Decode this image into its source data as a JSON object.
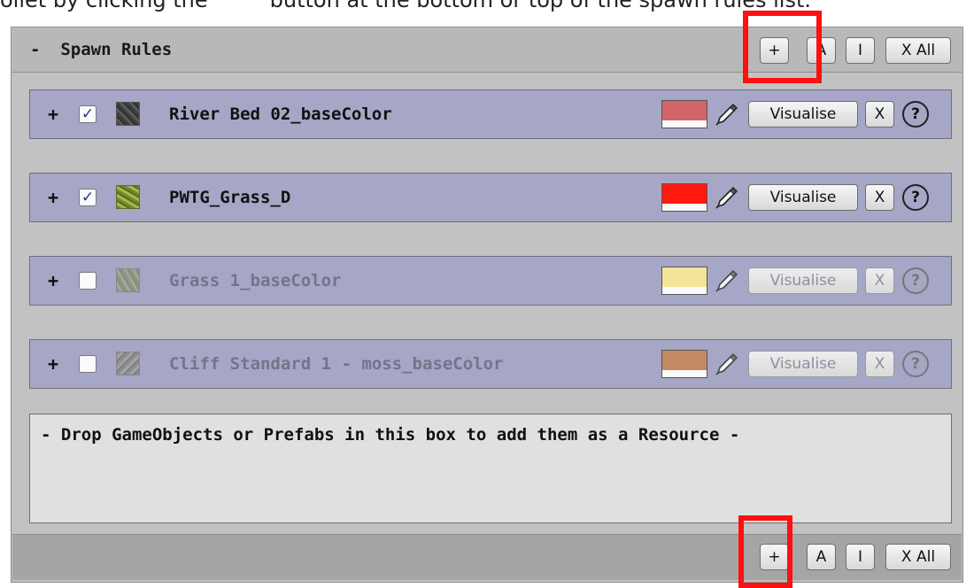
{
  "caption": {
    "before": "ollet by clicking the",
    "after": "button at the bottom or top of the spawn rules list."
  },
  "panel": {
    "collapse_symbol": "-",
    "title": "Spawn Rules"
  },
  "toolbar": {
    "add_label": "+",
    "all_label": "A",
    "invert_label": "I",
    "remove_all_label": "X All"
  },
  "rules": [
    {
      "expand": "+",
      "checked": true,
      "check_glyph": "✓",
      "name": "River Bed 02_baseColor",
      "color": "#d1656a",
      "enabled": true,
      "visualise": "Visualise",
      "remove": "X",
      "help": "?"
    },
    {
      "expand": "+",
      "checked": true,
      "check_glyph": "✓",
      "name": "PWTG_Grass_D",
      "color": "#ff1a0f",
      "enabled": true,
      "visualise": "Visualise",
      "remove": "X",
      "help": "?"
    },
    {
      "expand": "+",
      "checked": false,
      "check_glyph": "",
      "name": "Grass 1_baseColor",
      "color": "#f2e499",
      "enabled": false,
      "visualise": "Visualise",
      "remove": "X",
      "help": "?"
    },
    {
      "expand": "+",
      "checked": false,
      "check_glyph": "",
      "name": "Cliff Standard 1 - moss_baseColor",
      "color": "#c48a63",
      "enabled": false,
      "visualise": "Visualise",
      "remove": "X",
      "help": "?"
    }
  ],
  "drop_box": {
    "text": "- Drop GameObjects or Prefabs in this box to add them as a Resource -"
  },
  "colors": {
    "highlight": "#ff1010",
    "row_background": "#a6a6c6",
    "panel_background": "#c2c2c2"
  }
}
